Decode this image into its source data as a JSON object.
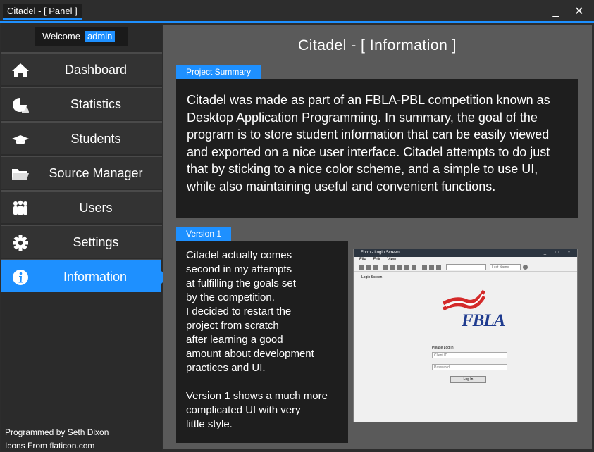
{
  "window": {
    "tab_title": "Citadel - [ Panel ]",
    "minimize_label": "_",
    "close_label": "✕"
  },
  "sidebar": {
    "welcome_label": "Welcome",
    "username": "admin",
    "items": [
      {
        "label": "Dashboard",
        "icon": "home-icon"
      },
      {
        "label": "Statistics",
        "icon": "pie-chart-icon"
      },
      {
        "label": "Students",
        "icon": "graduation-cap-icon"
      },
      {
        "label": "Source Manager",
        "icon": "folder-icon"
      },
      {
        "label": "Users",
        "icon": "users-icon"
      },
      {
        "label": "Settings",
        "icon": "gear-icon"
      },
      {
        "label": "Information",
        "icon": "info-icon",
        "active": true
      }
    ],
    "credits_line1": "Programmed by Seth Dixon",
    "credits_line2": "Icons From flaticon.com"
  },
  "main": {
    "title": "Citadel - [ Information ]",
    "summary": {
      "tab_label": "Project Summary",
      "text": "Citadel was made as part of an FBLA-PBL competition known as Desktop Application Programming. In summary, the goal of the program is to store student information that can be easily viewed and exported on a nice user interface. Citadel attempts to do just that by sticking to a nice color scheme, and a simple to use UI, while also maintaining useful and convenient functions."
    },
    "version": {
      "tab_label": "Version 1",
      "text": "Citadel actually comes\nsecond in my attempts\nat fulfilling the goals set\nby the competition.\nI decided to restart the\nproject from scratch\nafter learning a good\namount about development\npractices and UI.\n\nVersion 1 shows a much more\ncomplicated UI with very\nlittle style."
    },
    "screenshot": {
      "window_title": "Form - Login Screen",
      "window_controls": "_ □ x",
      "menu": "File Edit View",
      "select_value": "Last Name",
      "section_label": "Login Screen",
      "logo_text": "FBLA",
      "login_prompt": "Please Log In",
      "client_id_placeholder": "Client ID",
      "password_placeholder": "Password",
      "login_button": "Log In"
    }
  },
  "colors": {
    "accent": "#1e90ff",
    "sidebar_bg": "#333333",
    "main_bg": "#5a5a5a",
    "box_bg": "#1e1e1e"
  }
}
